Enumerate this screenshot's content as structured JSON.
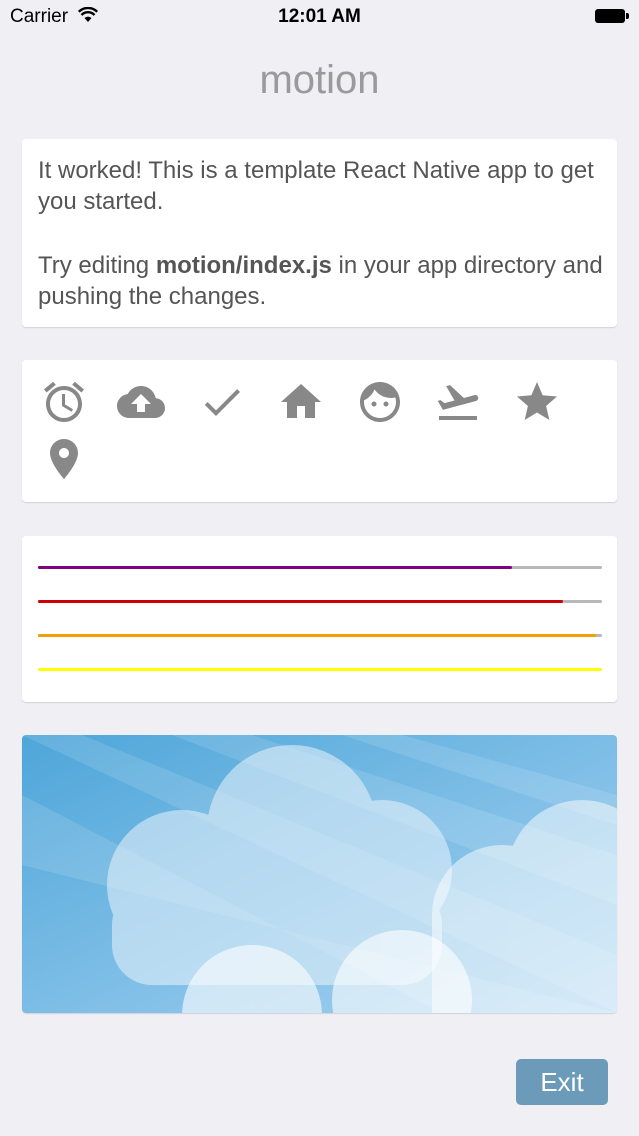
{
  "status_bar": {
    "carrier": "Carrier",
    "time": "12:01 AM"
  },
  "app": {
    "title": "motion"
  },
  "intro": {
    "line1": "It worked! This is a template React Native app to get you started.",
    "line2_prefix": "Try editing ",
    "line2_file": "motion/index.js",
    "line2_suffix": " in your app directory and pushing the changes."
  },
  "icons": [
    "alarm-icon",
    "cloud-upload-icon",
    "check-icon",
    "home-icon",
    "face-icon",
    "flight-takeoff-icon",
    "star-icon",
    "place-icon"
  ],
  "progress_bars": [
    {
      "color": "#800080",
      "value": 0.84
    },
    {
      "color": "#cc0000",
      "value": 0.93
    },
    {
      "color": "#f0a000",
      "value": 0.99
    },
    {
      "color": "#ffff00",
      "value": 1.0
    }
  ],
  "exit_button": {
    "label": "Exit"
  }
}
